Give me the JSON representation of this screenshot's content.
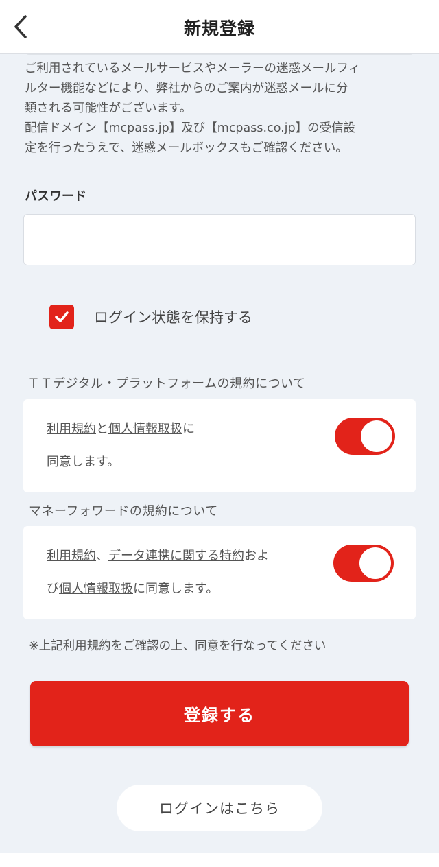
{
  "header": {
    "title": "新規登録",
    "back_icon": "chevron-left-icon"
  },
  "notice": {
    "line1": "ご利用されているメールサービスやメーラーの迷惑メールフィ",
    "line2": "ルター機能などにより、弊社からのご案内が迷惑メールに分",
    "line3": "類される可能性がございます。",
    "line4": "配信ドメイン【mcpass.jp】及び【mcpass.co.jp】の受信設",
    "line5": "定を行ったうえで、迷惑メールボックスもご確認ください。"
  },
  "password": {
    "label": "パスワード",
    "value": "",
    "placeholder": ""
  },
  "remember": {
    "label": "ログイン状態を保持する",
    "checked": true,
    "check_icon": "checkmark-icon"
  },
  "tt_terms": {
    "section_title": "ＴＴデジタル・プラットフォームの規約について",
    "link_terms": "利用規約",
    "connector1": "と",
    "link_privacy": "個人情報取扱",
    "suffix1": "に",
    "line2": "同意します。",
    "toggle_on": true
  },
  "mf_terms": {
    "section_title": "マネーフォワードの規約について",
    "link_terms": "利用規約",
    "connector1": "、",
    "link_special": "データ連携に関する特約",
    "connector2": "およ",
    "prefix2": "び",
    "link_privacy": "個人情報取扱",
    "suffix2": "に同意します。",
    "toggle_on": true
  },
  "footnote": "※上記利用規約をご確認の上、同意を行なってください",
  "register_button": "登録する",
  "login_link": "ログインはこちら",
  "colors": {
    "accent": "#e2231a",
    "background": "#eef2f7"
  }
}
